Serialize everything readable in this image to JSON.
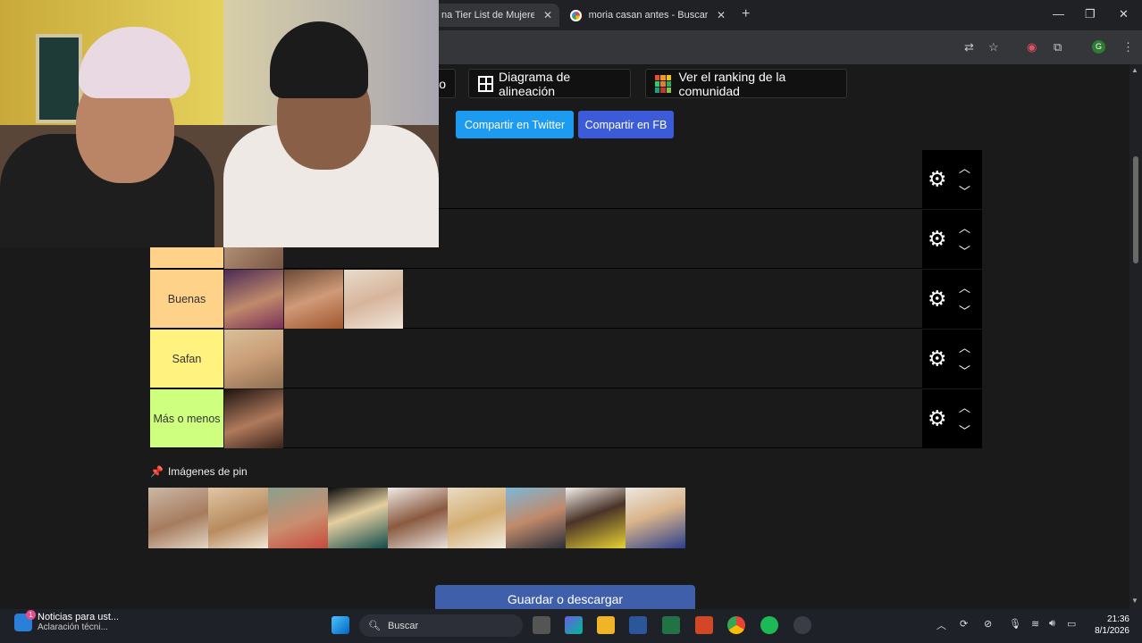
{
  "browser": {
    "tabs": [
      {
        "label": "na Tier List de Mujeres a"
      },
      {
        "label": "moria casan antes - Buscar con"
      }
    ],
    "close_glyph": "✕",
    "newtab_glyph": "+",
    "profile_initial": "G"
  },
  "toolbar": {
    "partial_button": "o",
    "alignment_button": "Diagrama de alineación",
    "community_button": "Ver el ranking de la comunidad",
    "share_twitter": "Compartir en Twitter",
    "share_fb": "Compartir en FB"
  },
  "tiers": [
    {
      "label": "",
      "color": "#ffd28a",
      "images": 1
    },
    {
      "label": "Buenas",
      "color": "#ffd28a",
      "images": 3
    },
    {
      "label": "Safan",
      "color": "#fff27f",
      "images": 1
    },
    {
      "label": "Más o menos",
      "color": "#cfff7f",
      "images": 1
    }
  ],
  "pin_section": {
    "label": "Imágenes de pin",
    "count": 9
  },
  "save_button": "Guardar o descargar",
  "taskbar": {
    "news_title": "Noticias para ust...",
    "news_sub": "Aclaración técni...",
    "news_badge": "1",
    "search_placeholder": "Buscar",
    "time": "21:36",
    "date": "8/1/2026"
  },
  "colors": {
    "twitter_blue": "#1d9bf0",
    "fb_blue": "#3b5bd8",
    "save_blue": "#3f5faa"
  }
}
